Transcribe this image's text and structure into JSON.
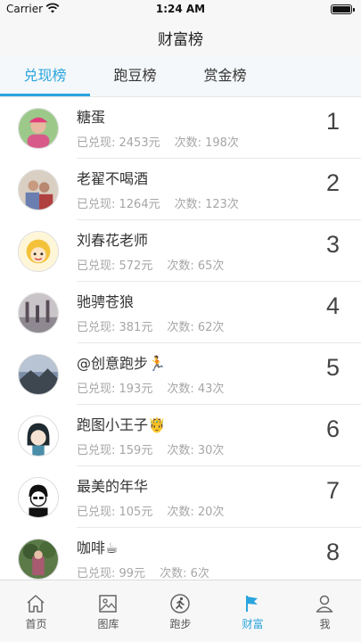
{
  "status_bar": {
    "carrier": "Carrier",
    "time": "1:24 AM"
  },
  "nav": {
    "title": "财富榜"
  },
  "tabs": [
    {
      "label": "兑现榜",
      "active": true
    },
    {
      "label": "跑豆榜",
      "active": false
    },
    {
      "label": "赏金榜",
      "active": false
    }
  ],
  "list": [
    {
      "name": "糖蛋",
      "cashed": "已兑现: 2453元",
      "count": "次数: 198次",
      "rank": "1"
    },
    {
      "name": "老翟不喝酒",
      "cashed": "已兑现: 1264元",
      "count": "次数: 123次",
      "rank": "2"
    },
    {
      "name": "刘春花老师",
      "cashed": "已兑现: 572元",
      "count": "次数: 65次",
      "rank": "3"
    },
    {
      "name": "驰骋苍狼",
      "cashed": "已兑现: 381元",
      "count": "次数: 62次",
      "rank": "4"
    },
    {
      "name": "@创意跑步🏃",
      "cashed": "已兑现: 193元",
      "count": "次数: 43次",
      "rank": "5"
    },
    {
      "name": "跑图小王子🤴",
      "cashed": "已兑现: 159元",
      "count": "次数: 30次",
      "rank": "6"
    },
    {
      "name": "最美的年华",
      "cashed": "已兑现: 105元",
      "count": "次数: 20次",
      "rank": "7"
    },
    {
      "name": "咖啡☕",
      "cashed": "已兑现: 99元",
      "count": "次数: 6次",
      "rank": "8"
    }
  ],
  "tabbar": [
    {
      "label": "首页",
      "icon": "home-icon",
      "active": false
    },
    {
      "label": "图库",
      "icon": "gallery-icon",
      "active": false
    },
    {
      "label": "跑步",
      "icon": "running-icon",
      "active": false
    },
    {
      "label": "财富",
      "icon": "flag-icon",
      "active": true
    },
    {
      "label": "我",
      "icon": "user-icon",
      "active": false
    }
  ],
  "colors": {
    "accent": "#2aa4dd",
    "muted_text": "#a6a6a6"
  }
}
